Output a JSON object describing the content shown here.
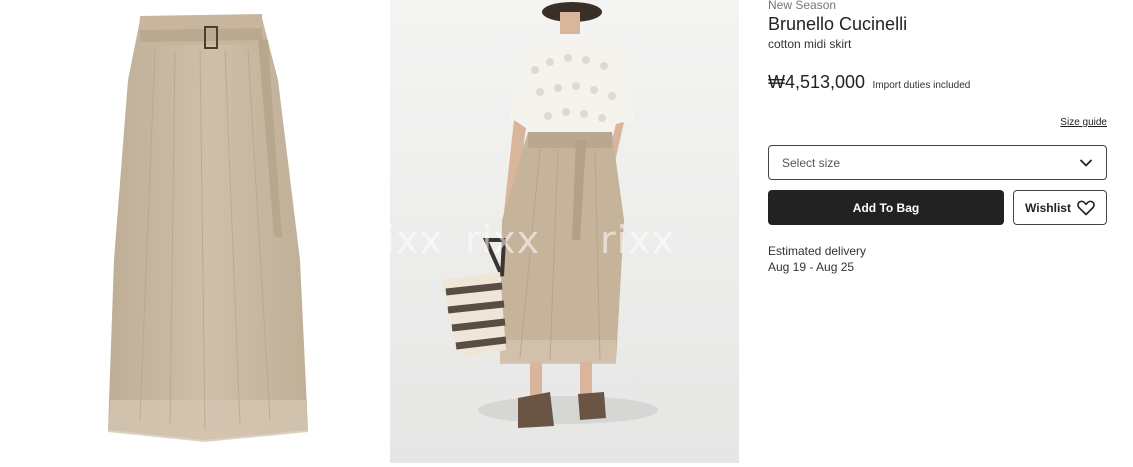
{
  "product": {
    "season_tag": "New Season",
    "brand": "Brunello Cucinelli",
    "name": "cotton midi skirt",
    "price": "₩4,513,000",
    "duties_note": "Import duties included",
    "size_guide_label": "Size guide",
    "size_select_placeholder": "Select size",
    "add_to_bag_label": "Add To Bag",
    "wishlist_label": "Wishlist",
    "delivery_label": "Estimated delivery",
    "delivery_dates": "Aug 19 - Aug 25"
  },
  "gallery": {
    "watermark": "rixx",
    "images": [
      {
        "alt": "skirt flat-lay"
      },
      {
        "alt": "model wearing skirt"
      }
    ]
  },
  "icons": {
    "select_chevron": "chevron-down-icon",
    "wishlist": "heart-icon"
  },
  "colors": {
    "primary_button": "#222222",
    "skirt": "#c9b9a2",
    "model_bg": "#f0f0ef"
  }
}
